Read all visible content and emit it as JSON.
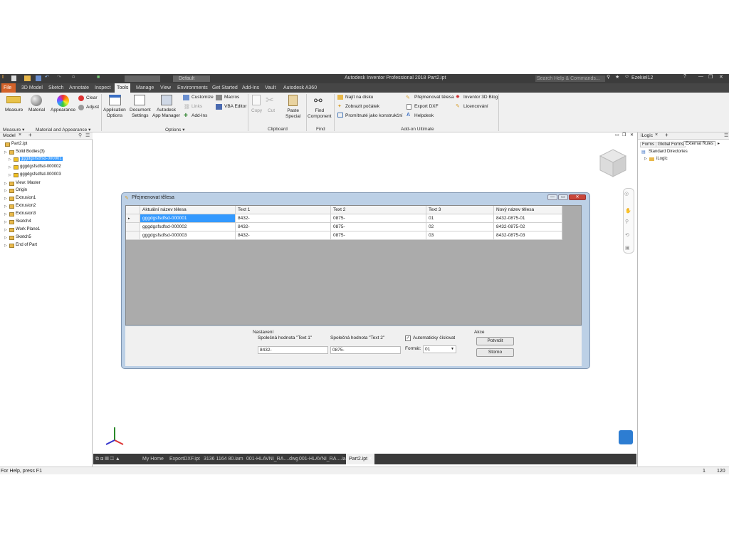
{
  "app_title": "Autodesk Inventor Professional 2018   Part2.ipt",
  "qat": {
    "appearance": "Default",
    "search_placeholder": "Search Help & Commands...",
    "user": "Ezekiel12"
  },
  "tabs": [
    "File",
    "3D Model",
    "Sketch",
    "Annotate",
    "Inspect",
    "Tools",
    "Manage",
    "View",
    "Environments",
    "Get Started",
    "Add-Ins",
    "Vault",
    "Autodesk A360"
  ],
  "ribbon": {
    "measure": "Measure",
    "material": "Material",
    "appearance": "Appearance",
    "clear": "Clear",
    "adjust": "Adjust",
    "application_options": "Application\nOptions",
    "document_settings": "Document\nSettings",
    "app_manager": "Autodesk\nApp Manager",
    "customize": "Customize",
    "links": "Links",
    "add_ins": "Add-Ins",
    "macros": "Macros",
    "vba_editor": "VBA Editor",
    "copy": "Copy",
    "cut": "Cut",
    "paste_special": "Paste\nSpecial",
    "find_component": "Find\nComponent",
    "najit_na_disku": "Najít na disku",
    "zobrazit_pocatek": "Zobrazit počátek",
    "promitnute": "Promítnuté jako konstrukční",
    "prejmenovat_telesa": "Přejmenovat tělesa",
    "export_dxf": "Export DXF",
    "helpdesk": "Helpdesk",
    "inventor_3d_blog": "Inventor 3D Blog",
    "licencovani": "Licencování",
    "panels": {
      "measure": "Measure ▾",
      "material_appearance": "Material and Appearance ▾",
      "options": "Options ▾",
      "clipboard": "Clipboard",
      "find": "Find",
      "addon": "Add-on Ultimate"
    }
  },
  "model_panel": {
    "tab": "Model",
    "items": [
      {
        "label": "Part2.ipt",
        "indent": 0
      },
      {
        "label": "Solid Bodies(3)",
        "indent": 1
      },
      {
        "label": "gggdgsfsdfsd-000001",
        "indent": 2,
        "selected": true
      },
      {
        "label": "gggdgsfsdfsd-000002",
        "indent": 2
      },
      {
        "label": "gggdgsfsdfsd-000003",
        "indent": 2
      },
      {
        "label": "View: Master",
        "indent": 1
      },
      {
        "label": "Origin",
        "indent": 1
      },
      {
        "label": "Extrusion1",
        "indent": 1
      },
      {
        "label": "Extrusion2",
        "indent": 1
      },
      {
        "label": "Extrusion3",
        "indent": 1
      },
      {
        "label": "Sketch4",
        "indent": 1
      },
      {
        "label": "Work Plane1",
        "indent": 1
      },
      {
        "label": "Sketch5",
        "indent": 1
      },
      {
        "label": "End of Part",
        "indent": 1
      }
    ]
  },
  "ilogic_panel": {
    "tab": "iLogic",
    "subtabs": [
      "Forms",
      "Global Forms",
      "External Rules"
    ],
    "tree": [
      "Standard Directories",
      "iLogic"
    ]
  },
  "dialog": {
    "title": "Přejmenovat tělesa",
    "columns": [
      "Aktuální název tělesa",
      "Text 1",
      "Text 2",
      "Text 3",
      "Nový název tělesa"
    ],
    "rows": [
      [
        "gggdgsfsdfsd-000001",
        "8432-",
        "0875-",
        "01",
        "8432-0875-01"
      ],
      [
        "gggdgsfsdfsd-000002",
        "8432-",
        "0875-",
        "02",
        "8432-0875-02"
      ],
      [
        "gggdgsfsdfsd-000003",
        "8432-",
        "0875-",
        "03",
        "8432-0875-03"
      ]
    ],
    "settings": {
      "group_label": "Nastavení",
      "text1_label": "Společná hodnota \"Text 1\"",
      "text1_value": "8432-",
      "text2_label": "Společná hodnota \"Text 2\"",
      "text2_value": "0875-",
      "auto_label": "Automaticky číslovat",
      "auto_checked": true,
      "format_label": "Formát:",
      "format_value": "01"
    },
    "actions": {
      "group_label": "Akce",
      "confirm": "Potvrdit",
      "cancel": "Storno"
    }
  },
  "doc_tabs": [
    "My Home",
    "ExportDXF.ipt",
    "3136 1164 80.iam",
    "001-HLAVNI_RA....dwg",
    "001-HLAVNI_RA....iam",
    "Part2.ipt"
  ],
  "status": {
    "help": "For Help, press F1",
    "count1": "1",
    "count2": "120"
  },
  "colors": {
    "file_tab": "#d4632a",
    "selected": "#3399ff",
    "dark_bar": "#3c3c3c"
  }
}
